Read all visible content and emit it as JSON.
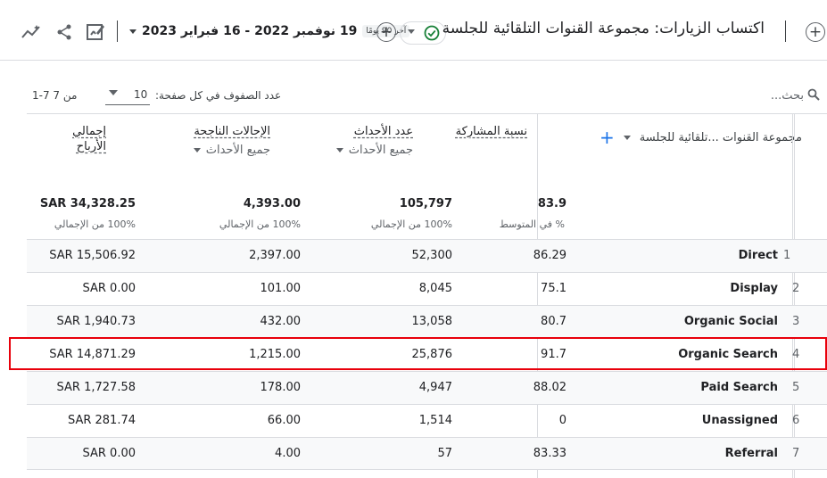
{
  "header": {
    "title": "اكتساب الزيارات: مجموعة القنوات التلقائية للجلسة",
    "date_badge": "آخر 90 يومًا",
    "date_range": "19 نوفمبر 2022 - 16 فبراير 2023"
  },
  "toolbar": {
    "search_placeholder": "بحث...",
    "rows_per_page_label": "عدد الصفوف في كل صفحة:",
    "rows_per_page_value": "10",
    "page_info": "1-7 من 7"
  },
  "columns": {
    "dimension": "مجموعة القنوات ...تلقائية للجلسة",
    "engagement": {
      "title": "نسبة المشاركة"
    },
    "events": {
      "title": "عدد الأحداث",
      "filter": "جميع الأحداث"
    },
    "conversions": {
      "title": "الإحالات الناجحة",
      "filter": "جميع الأحداث"
    },
    "revenue": {
      "title_line1": "إجمالي",
      "title_line2": "الأرباح"
    }
  },
  "totals": {
    "engagement": "83.9",
    "engagement_sub": "% في المتوسط",
    "events": "105,797",
    "events_sub": "100% من الإجمالي",
    "conversions": "4,393.00",
    "conversions_sub": "100% من الإجمالي",
    "revenue": "SAR 34,328.25",
    "revenue_sub": "100% من الإجمالي"
  },
  "rows": [
    {
      "index": "1",
      "channel": "Direct",
      "engagement": "86.29",
      "events": "52,300",
      "conversions": "2,397.00",
      "revenue": "SAR 15,506.92"
    },
    {
      "index": "2",
      "channel": "Display",
      "engagement": "75.1",
      "events": "8,045",
      "conversions": "101.00",
      "revenue": "SAR 0.00"
    },
    {
      "index": "3",
      "channel": "Organic Social",
      "engagement": "80.7",
      "events": "13,058",
      "conversions": "432.00",
      "revenue": "SAR 1,940.73"
    },
    {
      "index": "4",
      "channel": "Organic Search",
      "engagement": "91.7",
      "events": "25,876",
      "conversions": "1,215.00",
      "revenue": "SAR 14,871.29"
    },
    {
      "index": "5",
      "channel": "Paid Search",
      "engagement": "88.02",
      "events": "4,947",
      "conversions": "178.00",
      "revenue": "SAR 1,727.58"
    },
    {
      "index": "6",
      "channel": "Unassigned",
      "engagement": "0",
      "events": "1,514",
      "conversions": "66.00",
      "revenue": "SAR 281.74"
    },
    {
      "index": "7",
      "channel": "Referral",
      "engagement": "83.33",
      "events": "57",
      "conversions": "4.00",
      "revenue": "SAR 0.00"
    }
  ],
  "highlight_color": "#e8000b",
  "accent_color": "#1a73e8"
}
